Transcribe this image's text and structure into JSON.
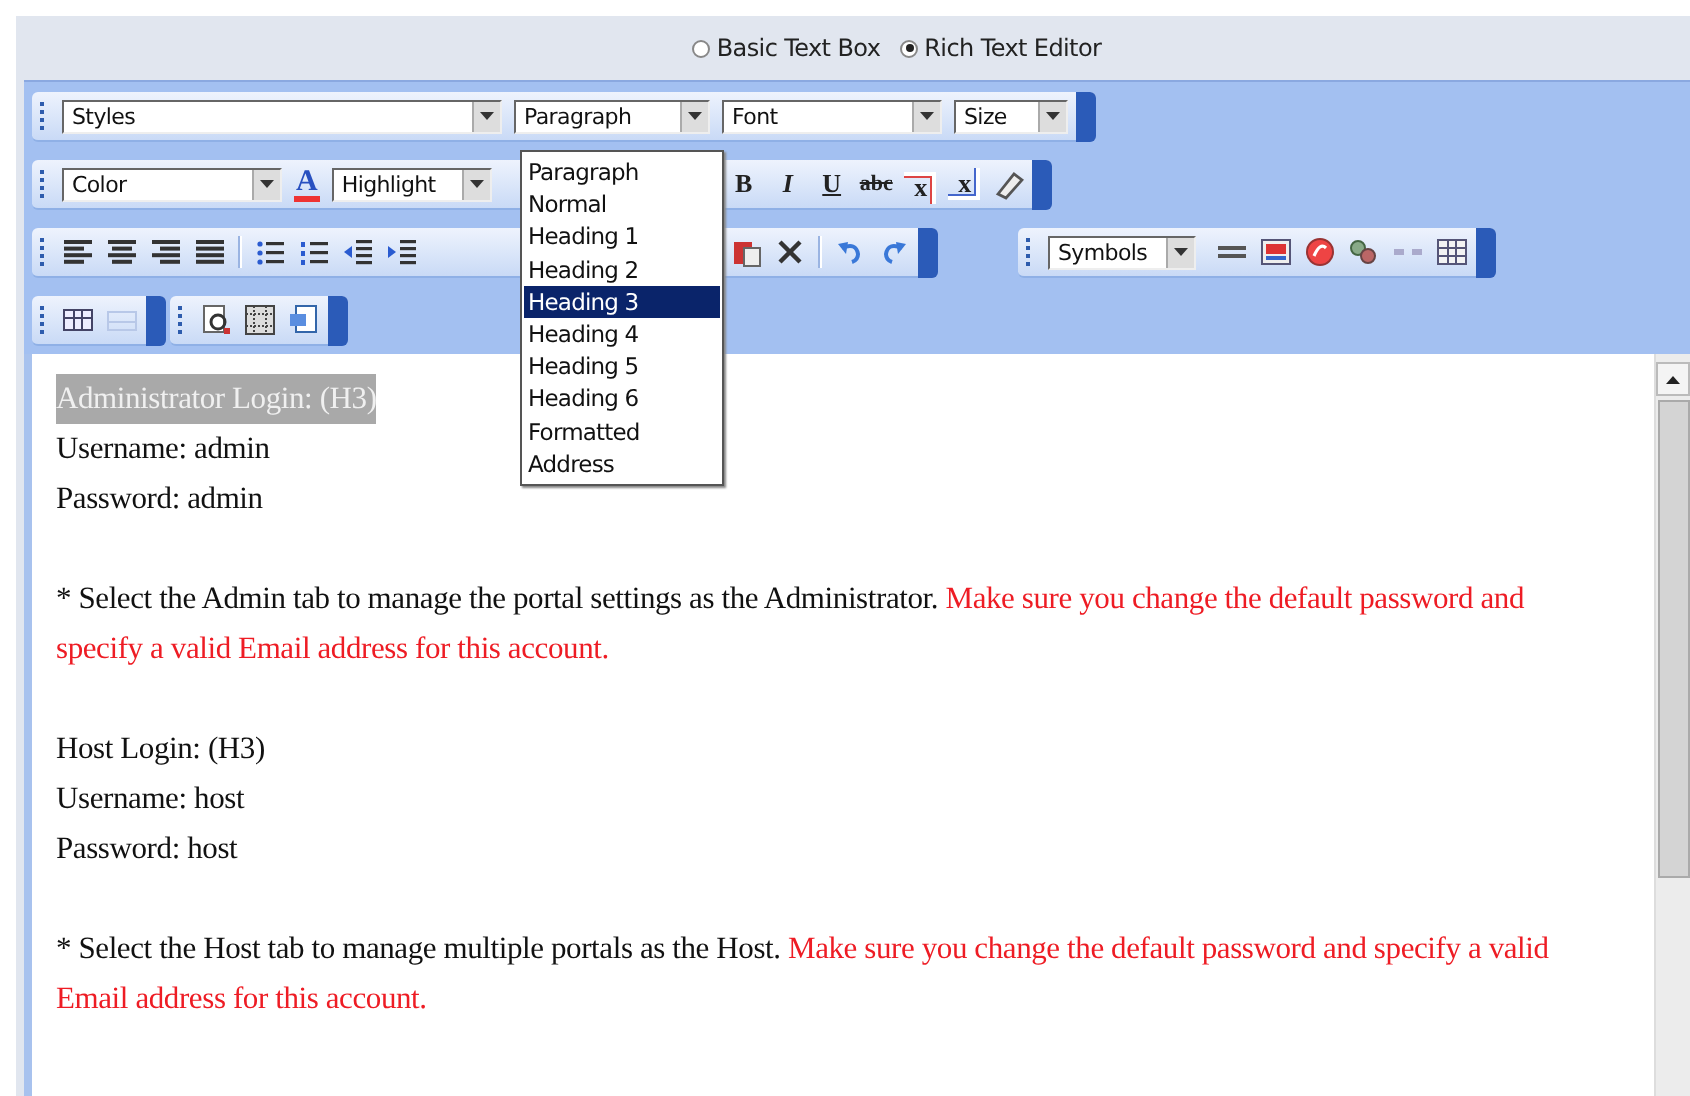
{
  "editor_mode": [
    {
      "label": "Basic Text Box",
      "selected": false
    },
    {
      "label": "Rich Text Editor",
      "selected": true
    }
  ],
  "toolbars": {
    "styles": "Styles",
    "paragraph": "Paragraph",
    "font": "Font",
    "size": "Size",
    "color_select": "Color",
    "font_color": "A",
    "highlight": "Highlight",
    "symbols": "Symbols",
    "format_buttons": [
      {
        "label": "B",
        "kind": "bold"
      },
      {
        "label": "I",
        "kind": "italic"
      },
      {
        "label": "U",
        "kind": "underline"
      },
      {
        "label": "abc",
        "kind": "strike"
      },
      {
        "label": "x",
        "kind": "superscript"
      },
      {
        "label": "x",
        "kind": "subscript"
      }
    ]
  },
  "paragraph_menu": {
    "options": [
      {
        "label": "Paragraph",
        "selected": false
      },
      {
        "label": "Normal",
        "selected": false
      },
      {
        "label": "Heading 1",
        "selected": false
      },
      {
        "label": "Heading 2",
        "selected": false
      },
      {
        "label": "Heading 3",
        "selected": true
      },
      {
        "label": "Heading 4",
        "selected": false
      },
      {
        "label": "Heading 5",
        "selected": false
      },
      {
        "label": "Heading 6",
        "selected": false
      },
      {
        "label": "Formatted",
        "selected": false
      },
      {
        "label": "Address",
        "selected": false
      }
    ]
  },
  "editor": {
    "blocks": [
      {
        "kind": "lines",
        "lines": [
          {
            "text": "Administrator Login: (H3)",
            "highlighted": true
          },
          {
            "text": "Username: admin",
            "highlighted": false
          },
          {
            "text": "Password: admin",
            "highlighted": false
          }
        ]
      },
      {
        "kind": "note",
        "text": "* Select the Admin tab to manage the portal settings as the Administrator.",
        "warning": "Make sure you change the default password and specify a valid Email address for this account."
      },
      {
        "kind": "lines",
        "lines": [
          {
            "text": "Host Login: (H3)",
            "highlighted": false
          },
          {
            "text": "Username: host",
            "highlighted": false
          },
          {
            "text": "Password: host",
            "highlighted": false
          }
        ]
      },
      {
        "kind": "note",
        "text": "* Select the Host tab to manage multiple portals as the Host.",
        "warning": "Make sure you change the default password and specify a valid Email address for this account."
      }
    ]
  }
}
